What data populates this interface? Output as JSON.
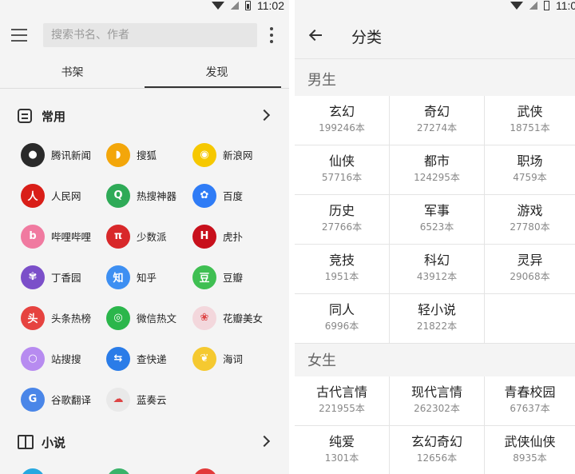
{
  "status": {
    "time": "11:02"
  },
  "left": {
    "search_placeholder": "搜索书名、作者",
    "tabs": [
      {
        "label": "书架",
        "active": false
      },
      {
        "label": "发现",
        "active": true
      }
    ],
    "sections": [
      {
        "title": "常用",
        "icon": "doc-icon"
      },
      {
        "title": "小说",
        "icon": "book-icon"
      }
    ],
    "sites": [
      [
        {
          "label": "腾讯新闻",
          "icon": "penguin-icon",
          "color": "#2a2a2a",
          "glyph": "●"
        },
        {
          "label": "搜狐",
          "icon": "fox-icon",
          "color": "#f3a60a",
          "glyph": "◗"
        },
        {
          "label": "新浪网",
          "icon": "sina-eye-icon",
          "color": "#f6c800",
          "glyph": "◉"
        }
      ],
      [
        {
          "label": "人民网",
          "icon": "people-daily-icon",
          "color": "#d91e18",
          "glyph": "人"
        },
        {
          "label": "热搜神器",
          "icon": "search-magnifier-icon",
          "color": "#2eaa57",
          "glyph": "Q"
        },
        {
          "label": "百度",
          "icon": "paw-icon",
          "color": "#2f7cf6",
          "glyph": "✿"
        }
      ],
      [
        {
          "label": "哔哩哔哩",
          "icon": "bilibili-icon",
          "color": "#f07aa0",
          "glyph": "b"
        },
        {
          "label": "少数派",
          "icon": "pi-icon",
          "color": "#d8282a",
          "glyph": "π"
        },
        {
          "label": "虎扑",
          "icon": "hupu-icon",
          "color": "#c8101c",
          "glyph": "H"
        }
      ],
      [
        {
          "label": "丁香园",
          "icon": "clove-flower-icon",
          "color": "#7b4fc9",
          "glyph": "✾"
        },
        {
          "label": "知乎",
          "icon": "zhihu-icon",
          "color": "#3d8ff2",
          "glyph": "知"
        },
        {
          "label": "豆瓣",
          "icon": "douban-icon",
          "color": "#3fbf52",
          "glyph": "豆"
        }
      ],
      [
        {
          "label": "头条热榜",
          "icon": "toutiao-icon",
          "color": "#e64340",
          "glyph": "头"
        },
        {
          "label": "微信热文",
          "icon": "wechat-icon",
          "color": "#2bb64b",
          "glyph": "◎"
        },
        {
          "label": "花瓣美女",
          "icon": "petal-icon",
          "color": "#f3d7dc",
          "glyph": "❀"
        }
      ],
      [
        {
          "label": "站搜搜",
          "icon": "site-search-icon",
          "color": "#b78bf0",
          "glyph": "○"
        },
        {
          "label": "查快递",
          "icon": "truck-icon",
          "color": "#2a7ce8",
          "glyph": "⇆"
        },
        {
          "label": "海词",
          "icon": "bee-icon",
          "color": "#f5c930",
          "glyph": "❦"
        }
      ],
      [
        {
          "label": "谷歌翻译",
          "icon": "google-translate-icon",
          "color": "#4a86e8",
          "glyph": "G"
        },
        {
          "label": "蓝奏云",
          "icon": "cloud-icon",
          "color": "#e9e9e9",
          "glyph": "☁"
        }
      ]
    ]
  },
  "right": {
    "title": "分类",
    "groups": [
      {
        "heading": "男生",
        "rows": [
          [
            {
              "name": "玄幻",
              "count": "199246本"
            },
            {
              "name": "奇幻",
              "count": "27274本"
            },
            {
              "name": "武侠",
              "count": "18751本"
            }
          ],
          [
            {
              "name": "仙侠",
              "count": "57716本"
            },
            {
              "name": "都市",
              "count": "124295本"
            },
            {
              "name": "职场",
              "count": "4759本"
            }
          ],
          [
            {
              "name": "历史",
              "count": "27766本"
            },
            {
              "name": "军事",
              "count": "6523本"
            },
            {
              "name": "游戏",
              "count": "27780本"
            }
          ],
          [
            {
              "name": "竞技",
              "count": "1951本"
            },
            {
              "name": "科幻",
              "count": "43912本"
            },
            {
              "name": "灵异",
              "count": "29068本"
            }
          ],
          [
            {
              "name": "同人",
              "count": "6996本"
            },
            {
              "name": "轻小说",
              "count": "21822本"
            },
            {
              "name": "",
              "count": ""
            }
          ]
        ]
      },
      {
        "heading": "女生",
        "rows": [
          [
            {
              "name": "古代言情",
              "count": "221955本"
            },
            {
              "name": "现代言情",
              "count": "262302本"
            },
            {
              "name": "青春校园",
              "count": "67637本"
            }
          ],
          [
            {
              "name": "纯爱",
              "count": "1301本"
            },
            {
              "name": "玄幻奇幻",
              "count": "12656本"
            },
            {
              "name": "武侠仙侠",
              "count": "8935本"
            }
          ]
        ]
      }
    ]
  }
}
